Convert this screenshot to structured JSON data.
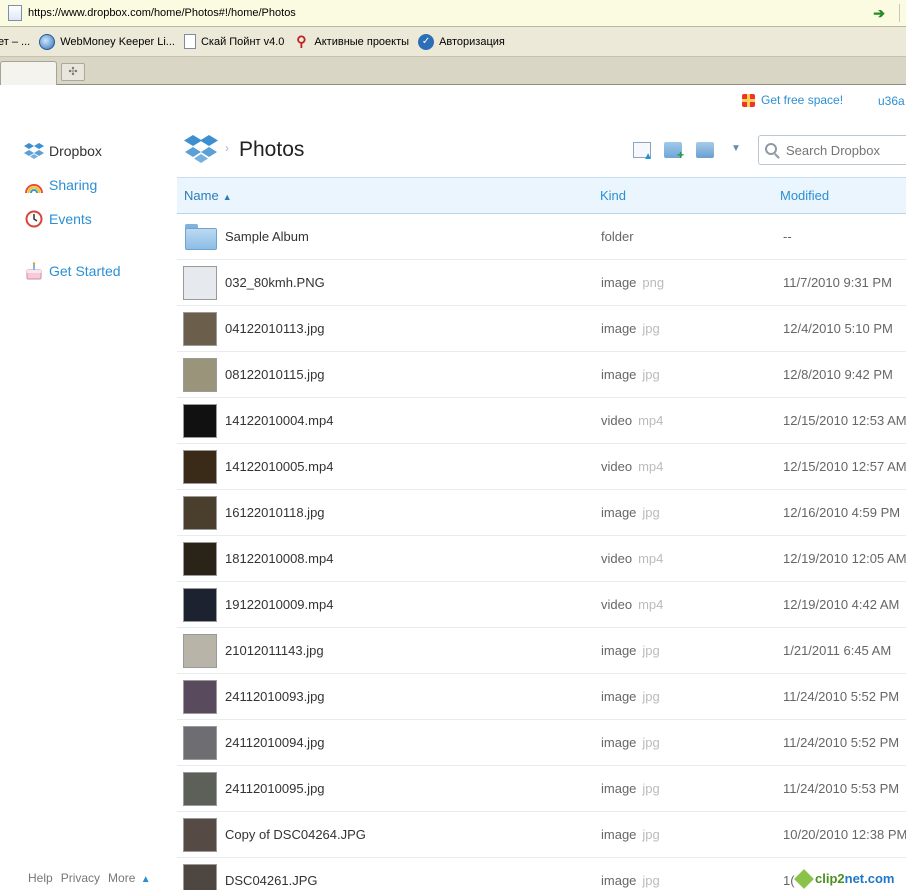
{
  "browser": {
    "url": "https://www.dropbox.com/home/Photos#!/home/Photos",
    "bookmarks": [
      "ет – ...",
      "WebMoney Keeper Li...",
      "Скай Пойнт v4.0",
      "Активные проекты",
      "Авторизация"
    ]
  },
  "top": {
    "free_space": "Get free space!",
    "user": "u36a"
  },
  "sidebar": {
    "items": [
      {
        "label": "Dropbox",
        "icon": "dropbox-icon"
      },
      {
        "label": "Sharing",
        "icon": "rainbow-icon"
      },
      {
        "label": "Events",
        "icon": "clock-icon"
      },
      {
        "label": "Get Started",
        "icon": "cake-icon"
      }
    ]
  },
  "header": {
    "title": "Photos",
    "search_placeholder": "Search Dropbox"
  },
  "table": {
    "columns": {
      "name": "Name",
      "kind": "Kind",
      "modified": "Modified"
    },
    "rows": [
      {
        "name": "Sample Album",
        "kind": "folder",
        "ext": "",
        "modified": "--",
        "thumb": "folder"
      },
      {
        "name": "032_80kmh.PNG",
        "kind": "image",
        "ext": "png",
        "modified": "11/7/2010 9:31 PM",
        "thumb": "#e6e9ee"
      },
      {
        "name": "04122010113.jpg",
        "kind": "image",
        "ext": "jpg",
        "modified": "12/4/2010 5:10 PM",
        "thumb": "#6b5e4a"
      },
      {
        "name": "08122010115.jpg",
        "kind": "image",
        "ext": "jpg",
        "modified": "12/8/2010 9:42 PM",
        "thumb": "#9a947a"
      },
      {
        "name": "14122010004.mp4",
        "kind": "video",
        "ext": "mp4",
        "modified": "12/15/2010 12:53 AM",
        "thumb": "#111111"
      },
      {
        "name": "14122010005.mp4",
        "kind": "video",
        "ext": "mp4",
        "modified": "12/15/2010 12:57 AM",
        "thumb": "#3a2a18"
      },
      {
        "name": "16122010118.jpg",
        "kind": "image",
        "ext": "jpg",
        "modified": "12/16/2010 4:59 PM",
        "thumb": "#4a3f2c"
      },
      {
        "name": "18122010008.mp4",
        "kind": "video",
        "ext": "mp4",
        "modified": "12/19/2010 12:05 AM",
        "thumb": "#2a2418"
      },
      {
        "name": "19122010009.mp4",
        "kind": "video",
        "ext": "mp4",
        "modified": "12/19/2010 4:42 AM",
        "thumb": "#1c2230"
      },
      {
        "name": "21012011143.jpg",
        "kind": "image",
        "ext": "jpg",
        "modified": "1/21/2011 6:45 AM",
        "thumb": "#b8b4a8"
      },
      {
        "name": "24112010093.jpg",
        "kind": "image",
        "ext": "jpg",
        "modified": "11/24/2010 5:52 PM",
        "thumb": "#5a4a5e"
      },
      {
        "name": "24112010094.jpg",
        "kind": "image",
        "ext": "jpg",
        "modified": "11/24/2010 5:52 PM",
        "thumb": "#6e6e72"
      },
      {
        "name": "24112010095.jpg",
        "kind": "image",
        "ext": "jpg",
        "modified": "11/24/2010 5:53 PM",
        "thumb": "#5c6058"
      },
      {
        "name": "Copy of DSC04264.JPG",
        "kind": "image",
        "ext": "jpg",
        "modified": "10/20/2010 12:38 PM",
        "thumb": "#554a44"
      },
      {
        "name": "DSC04261.JPG",
        "kind": "image",
        "ext": "jpg",
        "modified": "1(",
        "thumb": "#4e4640"
      }
    ]
  },
  "footer": {
    "links": [
      "Help",
      "Privacy",
      "More"
    ]
  },
  "watermark": {
    "part1": "clip2",
    "part2": "net.com"
  }
}
